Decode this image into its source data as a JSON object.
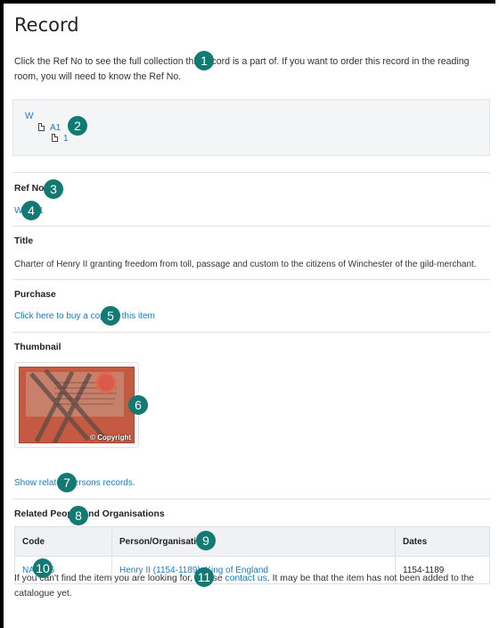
{
  "page": {
    "title": "Record",
    "intro": "Click the Ref No to see the full collection this record is a part of. If you want to order this record in the reading room, you will need to know the Ref No."
  },
  "tree": [
    {
      "label": "W"
    },
    {
      "label": "A1"
    },
    {
      "label": "1"
    }
  ],
  "sections": {
    "ref_no_label": "Ref No",
    "ref_no_value": "W/A1/1",
    "title_label": "Title",
    "title_value": "Charter of Henry II granting freedom from toll, passage and custom to the citizens of Winchester of the gild-merchant.",
    "purchase_label": "Purchase",
    "purchase_link": "Click here to buy a copy of this item",
    "thumbnail_label": "Thumbnail",
    "thumbnail_watermark": "© Copyright",
    "related_persons_link": "Show related persons records.",
    "related_label": "Related People and Organisations"
  },
  "table": {
    "headers": [
      "Code",
      "Person/Organisation",
      "Dates"
    ],
    "rows": [
      {
        "code": "NA1305",
        "person": "Henry II (1154-1189); King of England",
        "dates": "1154-1189"
      }
    ]
  },
  "footer": {
    "before": "If you can't find the item you are looking for, please ",
    "link": "contact us",
    "after": ". It may be that the item has not been added to the catalogue yet."
  },
  "markers": [
    "1",
    "2",
    "3",
    "4",
    "5",
    "6",
    "7",
    "8",
    "9",
    "10",
    "11"
  ],
  "colors": {
    "link": "#1a7bbf",
    "marker": "#127a73"
  }
}
